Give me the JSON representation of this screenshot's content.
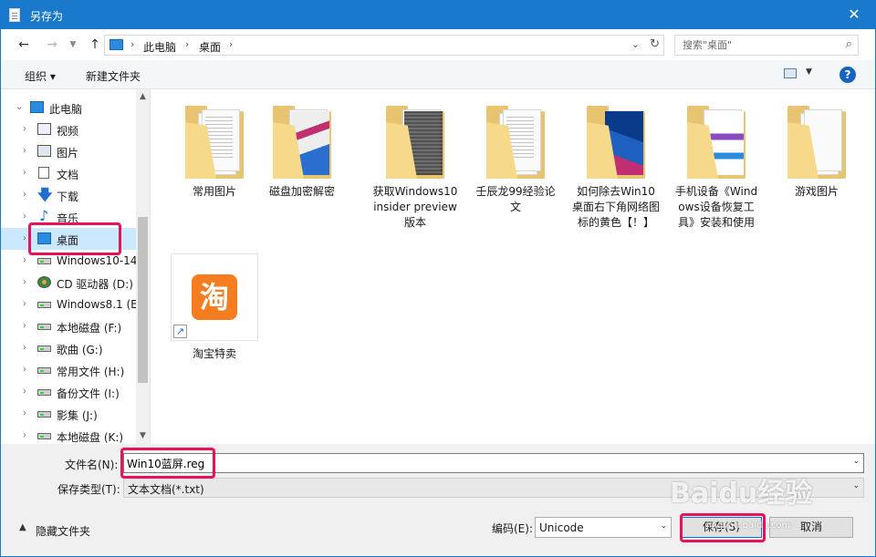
{
  "window": {
    "title": "另存为",
    "close_label": "✕"
  },
  "address": {
    "crumbs": [
      "此电脑",
      "桌面"
    ],
    "search_placeholder": "搜索\"桌面\""
  },
  "toolbar": {
    "organize_label": "组织 ▾",
    "new_folder_label": "新建文件夹",
    "help_label": "?"
  },
  "nav_tree": [
    {
      "label": "此电脑",
      "icon": "pc-icon",
      "expanded": true
    },
    {
      "label": "视频",
      "icon": "video-icon"
    },
    {
      "label": "图片",
      "icon": "picture-icon"
    },
    {
      "label": "文档",
      "icon": "document-icon"
    },
    {
      "label": "下载",
      "icon": "download-icon"
    },
    {
      "label": "音乐",
      "icon": "music-icon"
    },
    {
      "label": "桌面",
      "icon": "desktop-icon",
      "selected": true
    },
    {
      "label": "Windows10-14",
      "icon": "windows-drive-icon"
    },
    {
      "label": "CD 驱动器 (D:)",
      "icon": "cd-drive-icon"
    },
    {
      "label": "Windows8.1 (E",
      "icon": "drive-icon"
    },
    {
      "label": "本地磁盘 (F:)",
      "icon": "drive-icon"
    },
    {
      "label": "歌曲 (G:)",
      "icon": "drive-icon"
    },
    {
      "label": "常用文件 (H:)",
      "icon": "drive-icon"
    },
    {
      "label": "备份文件 (I:)",
      "icon": "drive-icon"
    },
    {
      "label": "影集 (J:)",
      "icon": "drive-icon"
    },
    {
      "label": "本地磁盘 (K:)",
      "icon": "drive-icon"
    }
  ],
  "files": [
    {
      "label": "常用图片",
      "type": "folder"
    },
    {
      "label": "磁盘加密解密",
      "type": "folder"
    },
    {
      "label": "获取Windows10 insider preview 版本",
      "type": "folder"
    },
    {
      "label": "壬辰龙99经验论文",
      "type": "folder"
    },
    {
      "label": "如何除去Win10桌面右下角网络图标的黄色【！】",
      "type": "folder"
    },
    {
      "label": "手机设备《Windows设备恢复工具》安装和使用",
      "type": "folder"
    },
    {
      "label": "游戏图片",
      "type": "folder"
    },
    {
      "label": "淘宝特卖",
      "type": "shortcut",
      "app_glyph": "淘"
    }
  ],
  "form": {
    "filename_label": "文件名(N):",
    "filename_value": "Win10蓝屏.reg",
    "filetype_label": "保存类型(T):",
    "filetype_value": "文本文档(*.txt)",
    "hide_folders_label": "隐藏文件夹",
    "encoding_label": "编码(E):",
    "encoding_value": "Unicode",
    "save_label": "保存(S)",
    "cancel_label": "取消"
  },
  "watermark": {
    "text": "Baidu经验",
    "sub": "jingyan.baidu.com"
  },
  "colors": {
    "titlebar": "#1979ca",
    "selection": "#cce8ff",
    "highlight": "#e8125c",
    "folder": "#e8c370"
  }
}
